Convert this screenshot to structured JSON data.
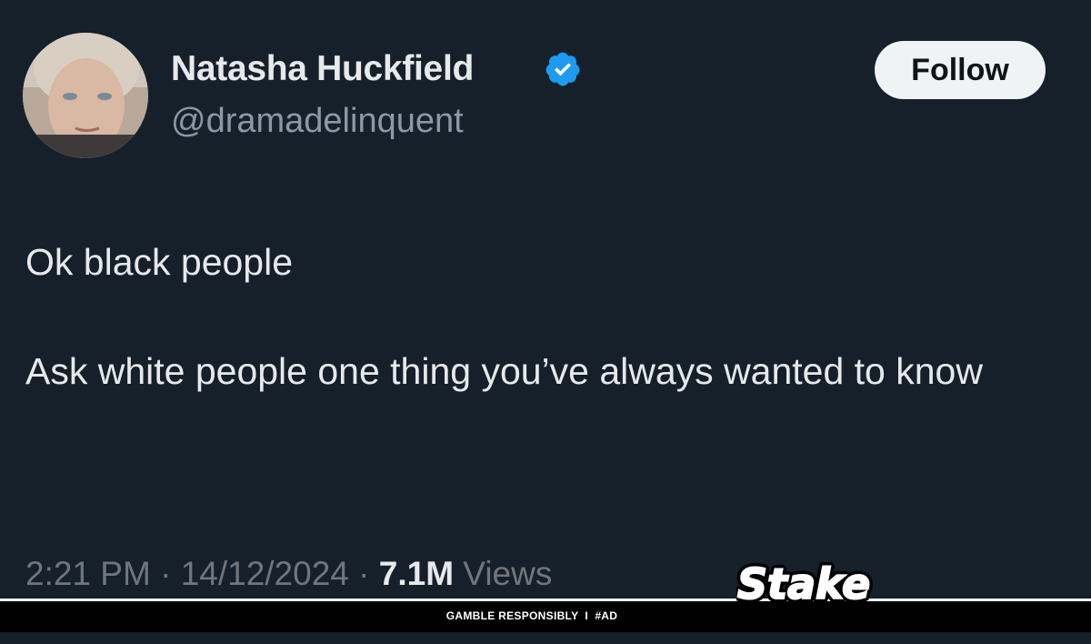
{
  "user": {
    "display_name": "Natasha Huckfield",
    "handle": "@dramadelinquent",
    "avatar_icon": "user-photo",
    "verified_icon": "verified-badge-icon",
    "verified_color": "#1d9bf0"
  },
  "follow_button": {
    "label": "Follow"
  },
  "tweet": {
    "line1": "Ok black people",
    "line2": "Ask white people one thing you’ve always wanted to know"
  },
  "meta": {
    "time": "2:21 PM",
    "separator1": " · ",
    "date": "14/12/2024",
    "separator2": " · ",
    "views_count": "7.1M",
    "views_label": " Views"
  },
  "ad": {
    "text": "GAMBLE RESPONSIBLY  I  #AD",
    "logo_text": "Stake"
  },
  "colors": {
    "background": "#15202b",
    "text": "#e7e9ea",
    "muted": "#8b98a5",
    "follow_bg": "#eff3f4"
  }
}
